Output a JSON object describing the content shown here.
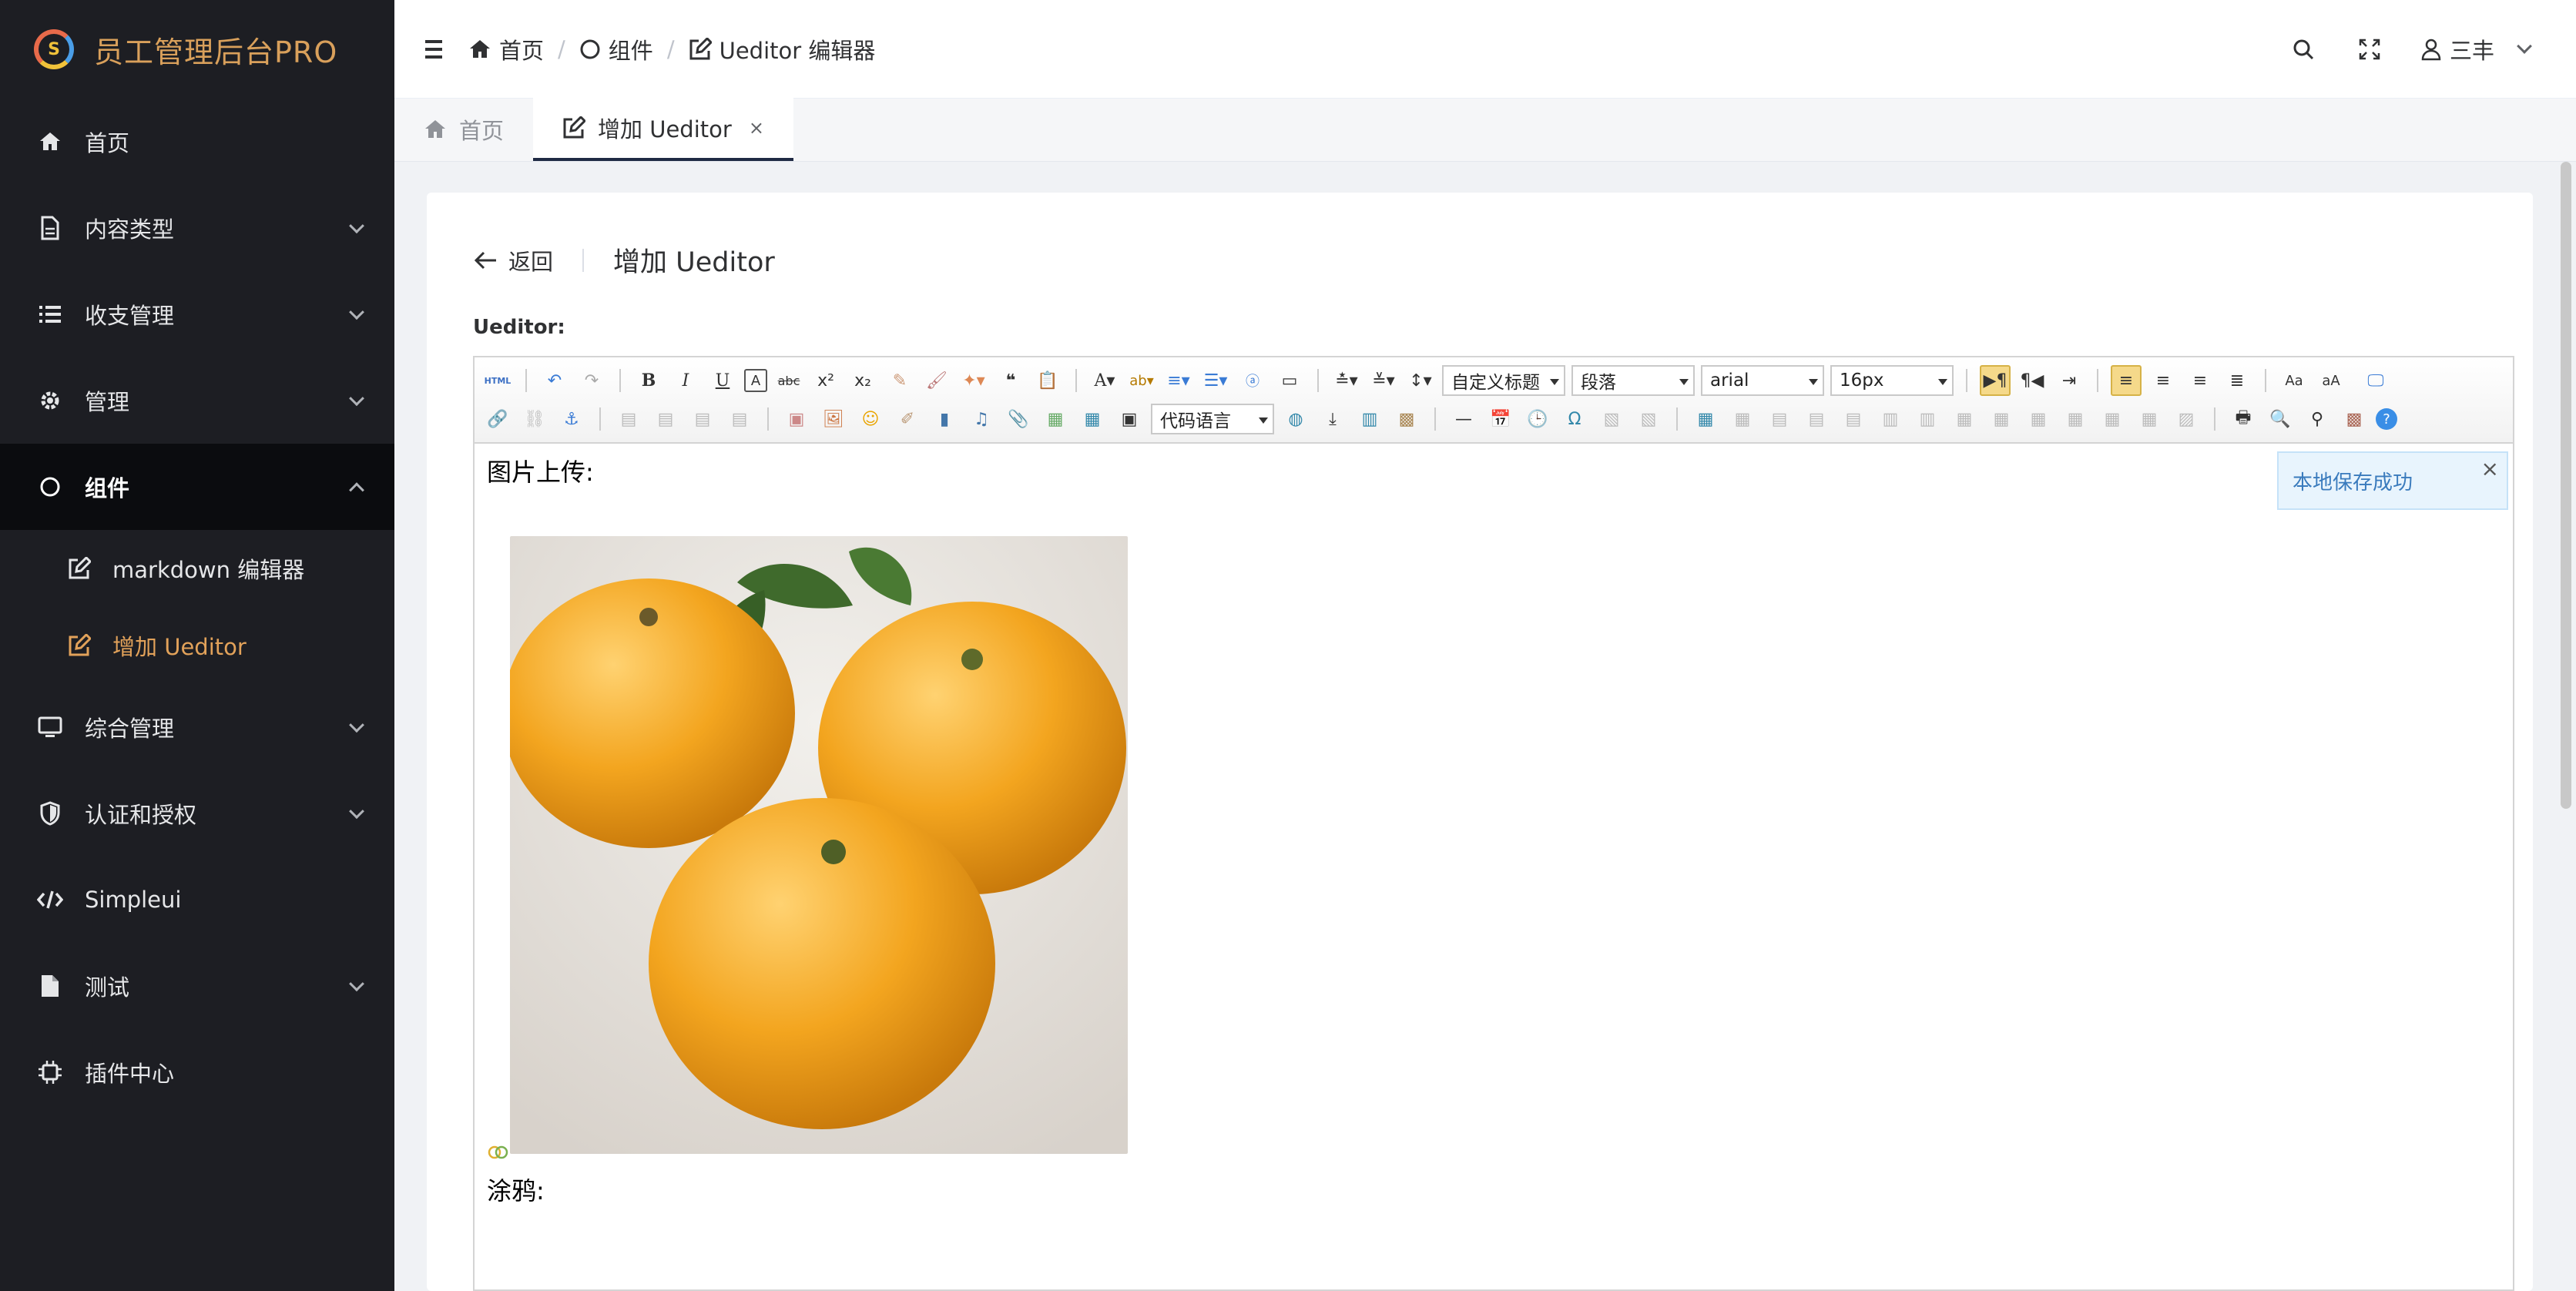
{
  "app": {
    "title": "员工管理后台PRO",
    "logo_letter": "S"
  },
  "sidebar": {
    "items": [
      {
        "label": "首页",
        "icon": "home-icon"
      },
      {
        "label": "内容类型",
        "icon": "document-icon"
      },
      {
        "label": "收支管理",
        "icon": "list-icon"
      },
      {
        "label": "管理",
        "icon": "gear-icon"
      },
      {
        "label": "组件",
        "icon": "circle-icon"
      },
      {
        "label": "综合管理",
        "icon": "monitor-icon"
      },
      {
        "label": "认证和授权",
        "icon": "shield-icon"
      },
      {
        "label": "Simpleui",
        "icon": "code-icon"
      },
      {
        "label": "测试",
        "icon": "file-icon"
      },
      {
        "label": "插件中心",
        "icon": "chip-icon"
      }
    ],
    "sub_items": [
      {
        "label": "markdown 编辑器",
        "icon": "edit-icon"
      },
      {
        "label": "增加 Ueditor",
        "icon": "edit-icon"
      }
    ]
  },
  "header": {
    "breadcrumb": [
      {
        "label": "首页",
        "icon": "home-icon"
      },
      {
        "label": "组件",
        "icon": "circle-icon"
      },
      {
        "label": "Ueditor 编辑器",
        "icon": "edit-icon"
      }
    ],
    "separator": "/",
    "user": "三丰"
  },
  "tabs": [
    {
      "label": "首页",
      "icon": "home-icon"
    },
    {
      "label": "增加 Ueditor",
      "icon": "edit-icon",
      "close": "×"
    }
  ],
  "page": {
    "back_label": "返回",
    "title": "增加 Ueditor",
    "field_label": "Ueditor:"
  },
  "editor": {
    "selects": {
      "custom_title": "自定义标题",
      "paragraph": "段落",
      "font": "arial",
      "size": "16px",
      "code_language": "代码语言"
    },
    "toolbar_html_label": "HTML",
    "content": {
      "line1": "图片上传:",
      "line2": "涂鸦:"
    },
    "toast": {
      "message": "本地保存成功",
      "close": "×"
    }
  },
  "colors": {
    "sidebar_bg": "#1d1e23",
    "accent": "#e2a25a",
    "active_tab_border": "#1f2a44"
  }
}
